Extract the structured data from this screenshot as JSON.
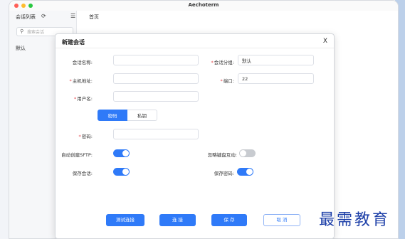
{
  "app": {
    "window_title": "Aechoterm",
    "sidebar": {
      "heading": "会话列表",
      "refresh_icon": "refresh-icon",
      "collapse_icon": "menu-collapse-icon",
      "search_placeholder": "搜索会话",
      "group_label": "默认"
    },
    "tabs": [
      {
        "label": "首页"
      }
    ]
  },
  "dialog": {
    "title": "新建会话",
    "close_glyph": "X",
    "fields": {
      "session_name": {
        "label": "会话名称:",
        "value": "",
        "required": false
      },
      "session_group": {
        "label": "会话分组:",
        "value": "默认",
        "required": true
      },
      "host": {
        "label": "主机地址:",
        "value": "",
        "required": true
      },
      "port": {
        "label": "端口:",
        "value": "22",
        "required": true
      },
      "username": {
        "label": "用户名:",
        "value": "",
        "required": true
      },
      "password": {
        "label": "密码:",
        "value": "",
        "required": true
      }
    },
    "auth_tabs": {
      "password": "密码",
      "private_key": "私钥",
      "selected": "password"
    },
    "toggles": {
      "auto_sftp": {
        "label": "自动创建SFTP:",
        "on": true
      },
      "ignore_keyboard": {
        "label": "忽略键盘互动:",
        "on": false
      },
      "save_session": {
        "label": "保存会话:",
        "on": true
      },
      "save_password": {
        "label": "保存密码:",
        "on": true
      }
    },
    "buttons": {
      "test": "测试连接",
      "connect": "连 接",
      "save": "保 存",
      "cancel": "取 消"
    }
  },
  "watermark": "最需教育",
  "colors": {
    "accent": "#2f7af8",
    "required": "#e5484d",
    "toggle_off": "#c8cbd0",
    "watermark": "#1d3fa8"
  }
}
